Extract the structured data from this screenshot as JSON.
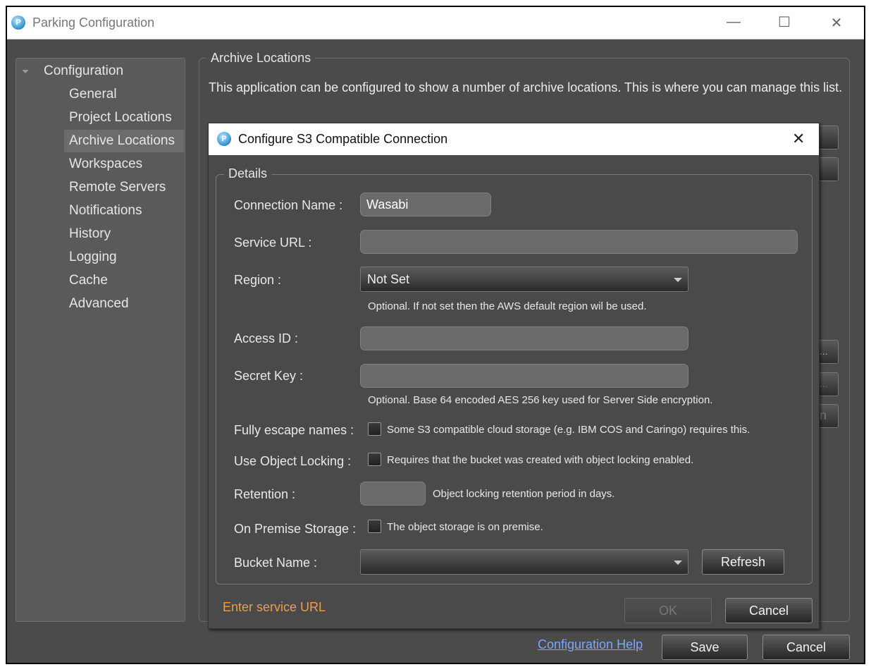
{
  "window": {
    "title": "Parking Configuration",
    "icon": "app-logo-icon",
    "controls": {
      "minimize": "—",
      "maximize": "☐",
      "close": "✕"
    }
  },
  "sidebar": {
    "root": "Configuration",
    "items": [
      {
        "label": "General"
      },
      {
        "label": "Project Locations"
      },
      {
        "label": "Archive Locations",
        "selected": true
      },
      {
        "label": "Workspaces"
      },
      {
        "label": "Remote Servers"
      },
      {
        "label": "Notifications"
      },
      {
        "label": "History"
      },
      {
        "label": "Logging"
      },
      {
        "label": "Cache"
      },
      {
        "label": "Advanced"
      }
    ]
  },
  "main": {
    "group_title": "Archive Locations",
    "description": "This application can be configured to show a number of archive locations. This is where you can manage this list.",
    "partial_buttons": [
      "...",
      "...",
      "n"
    ]
  },
  "dialog": {
    "title": "Configure S3 Compatible Connection",
    "group_title": "Details",
    "fields": {
      "connection_name": {
        "label": "Connection Name :",
        "value": "Wasabi"
      },
      "service_url": {
        "label": "Service URL :",
        "value": ""
      },
      "region": {
        "label": "Region :",
        "value": "Not Set",
        "hint": "Optional. If not set then the AWS default region wil be used."
      },
      "access_id": {
        "label": "Access ID :",
        "value": ""
      },
      "secret_key": {
        "label": "Secret Key :",
        "value": "",
        "hint": "Optional. Base 64 encoded AES 256 key used for Server Side encryption."
      },
      "fully_escape": {
        "label": "Fully escape names :",
        "checked": false,
        "text": "Some S3 compatible cloud storage (e.g. IBM COS and Caringo) requires this."
      },
      "object_locking": {
        "label": "Use Object Locking :",
        "checked": false,
        "text": "Requires that the bucket was created with object locking enabled."
      },
      "retention": {
        "label": "Retention :",
        "value": "",
        "text": "Object locking retention period in days."
      },
      "on_premise": {
        "label": "On Premise Storage :",
        "checked": false,
        "text": "The object storage is on premise."
      },
      "bucket_name": {
        "label": "Bucket Name :",
        "value": "",
        "refresh": "Refresh"
      }
    },
    "status": "Enter service URL",
    "status_color": "#e8a04a",
    "ok": "OK",
    "cancel": "Cancel",
    "close": "✕"
  },
  "footer": {
    "help_link": "Configuration Help",
    "save": "Save",
    "cancel": "Cancel",
    "link_color": "#7aa6ff"
  }
}
